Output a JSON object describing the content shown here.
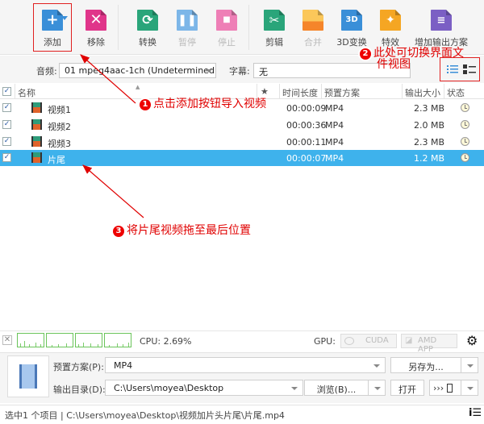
{
  "toolbar": {
    "items": [
      {
        "id": "add",
        "label": "添加",
        "icon": "add-file-icon",
        "color": "#3a8fd8",
        "enabled": true
      },
      {
        "id": "remove",
        "label": "移除",
        "icon": "remove-file-icon",
        "color": "#e0358a",
        "enabled": true
      },
      {
        "id": "convert",
        "label": "转换",
        "icon": "convert-icon",
        "color": "#2aa57a",
        "enabled": true
      },
      {
        "id": "pause",
        "label": "暂停",
        "icon": "pause-icon",
        "color": "#3a8fd8",
        "enabled": false
      },
      {
        "id": "stop",
        "label": "停止",
        "icon": "stop-icon",
        "color": "#e0358a",
        "enabled": false
      },
      {
        "id": "cut",
        "label": "剪辑",
        "icon": "scissors-icon",
        "color": "#2aa57a",
        "enabled": true
      },
      {
        "id": "merge",
        "label": "合并",
        "icon": "merge-icon",
        "color": "#f5a623",
        "enabled": false
      },
      {
        "id": "3d",
        "label": "3D变换",
        "icon": "3d-icon",
        "color": "#3a8fd8",
        "enabled": true
      },
      {
        "id": "effects",
        "label": "特效",
        "icon": "magic-wand-icon",
        "color": "#f5a623",
        "enabled": true
      },
      {
        "id": "addprofile",
        "label": "增加输出方案",
        "icon": "add-profile-icon",
        "color": "#7b5fc4",
        "enabled": true
      }
    ]
  },
  "options": {
    "audio_label": "音频:",
    "audio_value": "01 mpeg4aac-1ch (Undetermined",
    "subtitle_label": "字幕:",
    "subtitle_value": "无"
  },
  "table": {
    "headers": {
      "name": "名称",
      "star": "★",
      "duration": "时间长度",
      "preset": "预置方案",
      "size": "输出大小",
      "status": "状态"
    },
    "rows": [
      {
        "name": "视频1",
        "duration": "00:00:09",
        "preset": "MP4",
        "size": "2.3 MB",
        "checked": true,
        "selected": false
      },
      {
        "name": "视频2",
        "duration": "00:00:36",
        "preset": "MP4",
        "size": "2.0 MB",
        "checked": true,
        "selected": false
      },
      {
        "name": "视频3",
        "duration": "00:00:11",
        "preset": "MP4",
        "size": "2.3 MB",
        "checked": true,
        "selected": false
      },
      {
        "name": "片尾",
        "duration": "00:00:07",
        "preset": "MP4",
        "size": "1.2 MB",
        "checked": true,
        "selected": true
      }
    ]
  },
  "annotations": {
    "a1": {
      "num": "1",
      "text": "点击添加按钮导入视频"
    },
    "a2": {
      "num": "2",
      "line1": "此处可切换界面文",
      "line2": "件视图"
    },
    "a3": {
      "num": "3",
      "text": "将片尾视频拖至最后位置"
    }
  },
  "monitor": {
    "cpu_text": "CPU: 2.69%",
    "gpu_label": "GPU:",
    "cuda": "CUDA",
    "amd": "AMD APP"
  },
  "output": {
    "preset_label": "预置方案(P):",
    "preset_value": "MP4",
    "save_as": "另存为...",
    "dir_label": "输出目录(D):",
    "dir_value": "C:\\Users\\moyea\\Desktop",
    "browse": "浏览(B)...",
    "open": "打开",
    "export_glyph": "›››"
  },
  "status": {
    "text": "选中1 个项目 | C:\\Users\\moyea\\Desktop\\视频加片头片尾\\片尾.mp4"
  },
  "colors": {
    "accent": "#3eb2ec",
    "annotation": "#e00000"
  }
}
